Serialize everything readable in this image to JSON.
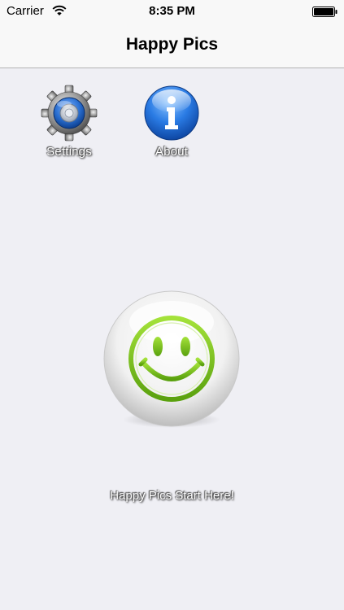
{
  "status_bar": {
    "carrier": "Carrier",
    "time": "8:35 PM",
    "wifi_icon": "wifi-icon",
    "battery_icon": "battery-icon"
  },
  "nav": {
    "title": "Happy Pics"
  },
  "launchers": {
    "settings": {
      "label": "Settings",
      "icon": "gear-icon"
    },
    "about": {
      "label": "About",
      "icon": "info-icon"
    }
  },
  "main": {
    "start_button_icon": "smiley-icon",
    "start_label": "Happy Pics Start Here!"
  },
  "colors": {
    "background": "#efeff4",
    "nav_background": "#f8f8f8",
    "smiley_green": "#7dc41a",
    "info_blue": "#1f6fd6",
    "gear_blue": "#2a6fd1"
  }
}
